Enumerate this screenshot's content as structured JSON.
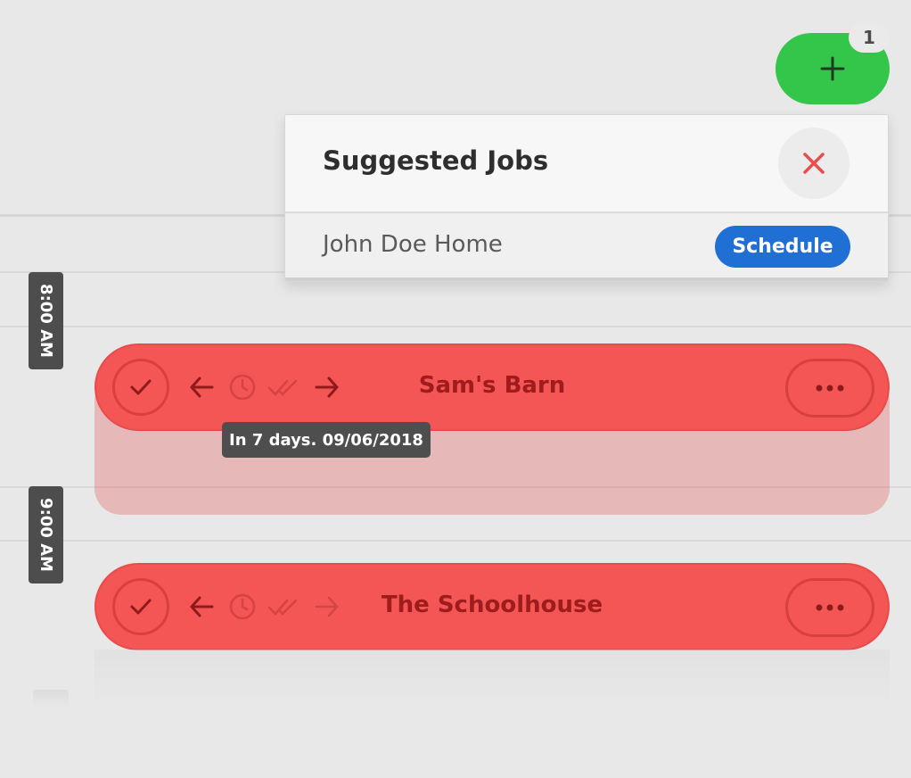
{
  "header": {
    "add_icon": "plus-icon",
    "notification_count": "1"
  },
  "suggested_jobs": {
    "title": "Suggested Jobs",
    "close_icon": "close-icon",
    "items": [
      {
        "name": "John Doe Home",
        "action_label": "Schedule"
      }
    ]
  },
  "timeline": {
    "time_labels": [
      "8:00 AM",
      "9:00 AM"
    ],
    "jobs": [
      {
        "title": "Sam's Barn",
        "tooltip": "In 7 days. 09/06/2018"
      },
      {
        "title": "The Schoolhouse"
      }
    ]
  },
  "colors": {
    "add_button": "#34c64a",
    "job_bar": "#f45555",
    "schedule_button": "#1f6fd4",
    "close_x": "#e84d4d"
  }
}
